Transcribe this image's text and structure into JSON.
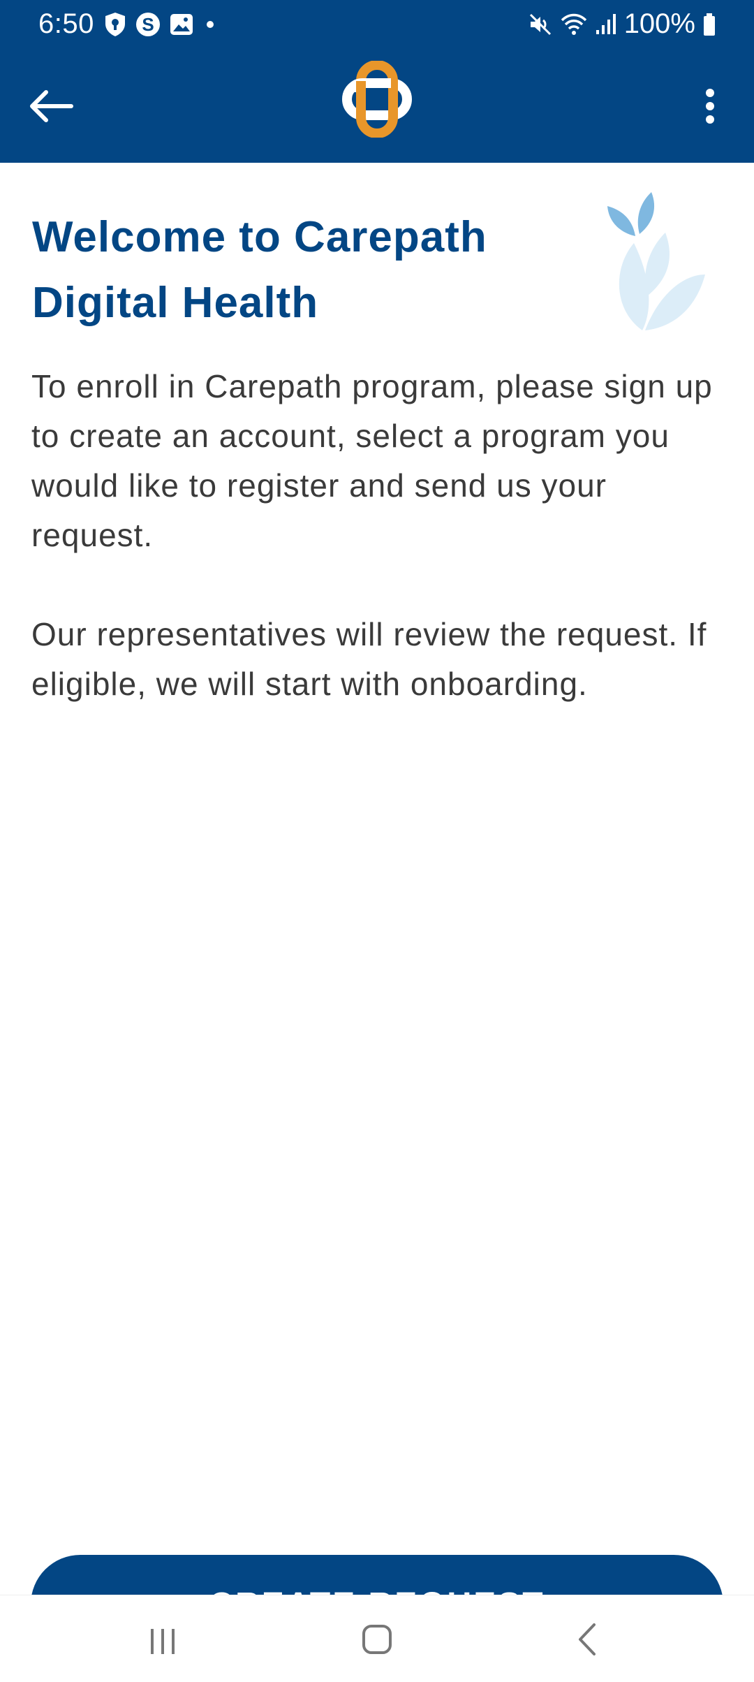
{
  "status_bar": {
    "time": "6:50",
    "battery": "100%",
    "left_icons": [
      "shield-icon",
      "s-badge-icon",
      "gallery-icon",
      "dot-icon"
    ],
    "right_icons": [
      "mute-icon",
      "wifi-icon",
      "signal-icon",
      "battery-icon"
    ]
  },
  "app_bar": {
    "back_icon": "arrow-left-icon",
    "logo_icon": "carepath-logo-icon",
    "more_icon": "more-vertical-icon"
  },
  "content": {
    "title": "Welcome to Carepath Digital Health",
    "paragraph_1": "To enroll in Carepath program, please sign up to create an account, select a program you would like to register and send us your request.",
    "paragraph_2": "Our representatives will review the request. If eligible, we will start with onboarding.",
    "decoration_icon": "leaf-icon"
  },
  "actions": {
    "create_request_label": "CREATE REQUEST"
  },
  "nav_bar": {
    "icons": [
      "recents-icon",
      "home-icon",
      "back-icon"
    ]
  },
  "colors": {
    "primary": "#034684",
    "accent": "#E8962A",
    "text": "#3a3a3a",
    "leaf_light": "#dcedf8",
    "leaf_dark": "#7fb8e0"
  }
}
